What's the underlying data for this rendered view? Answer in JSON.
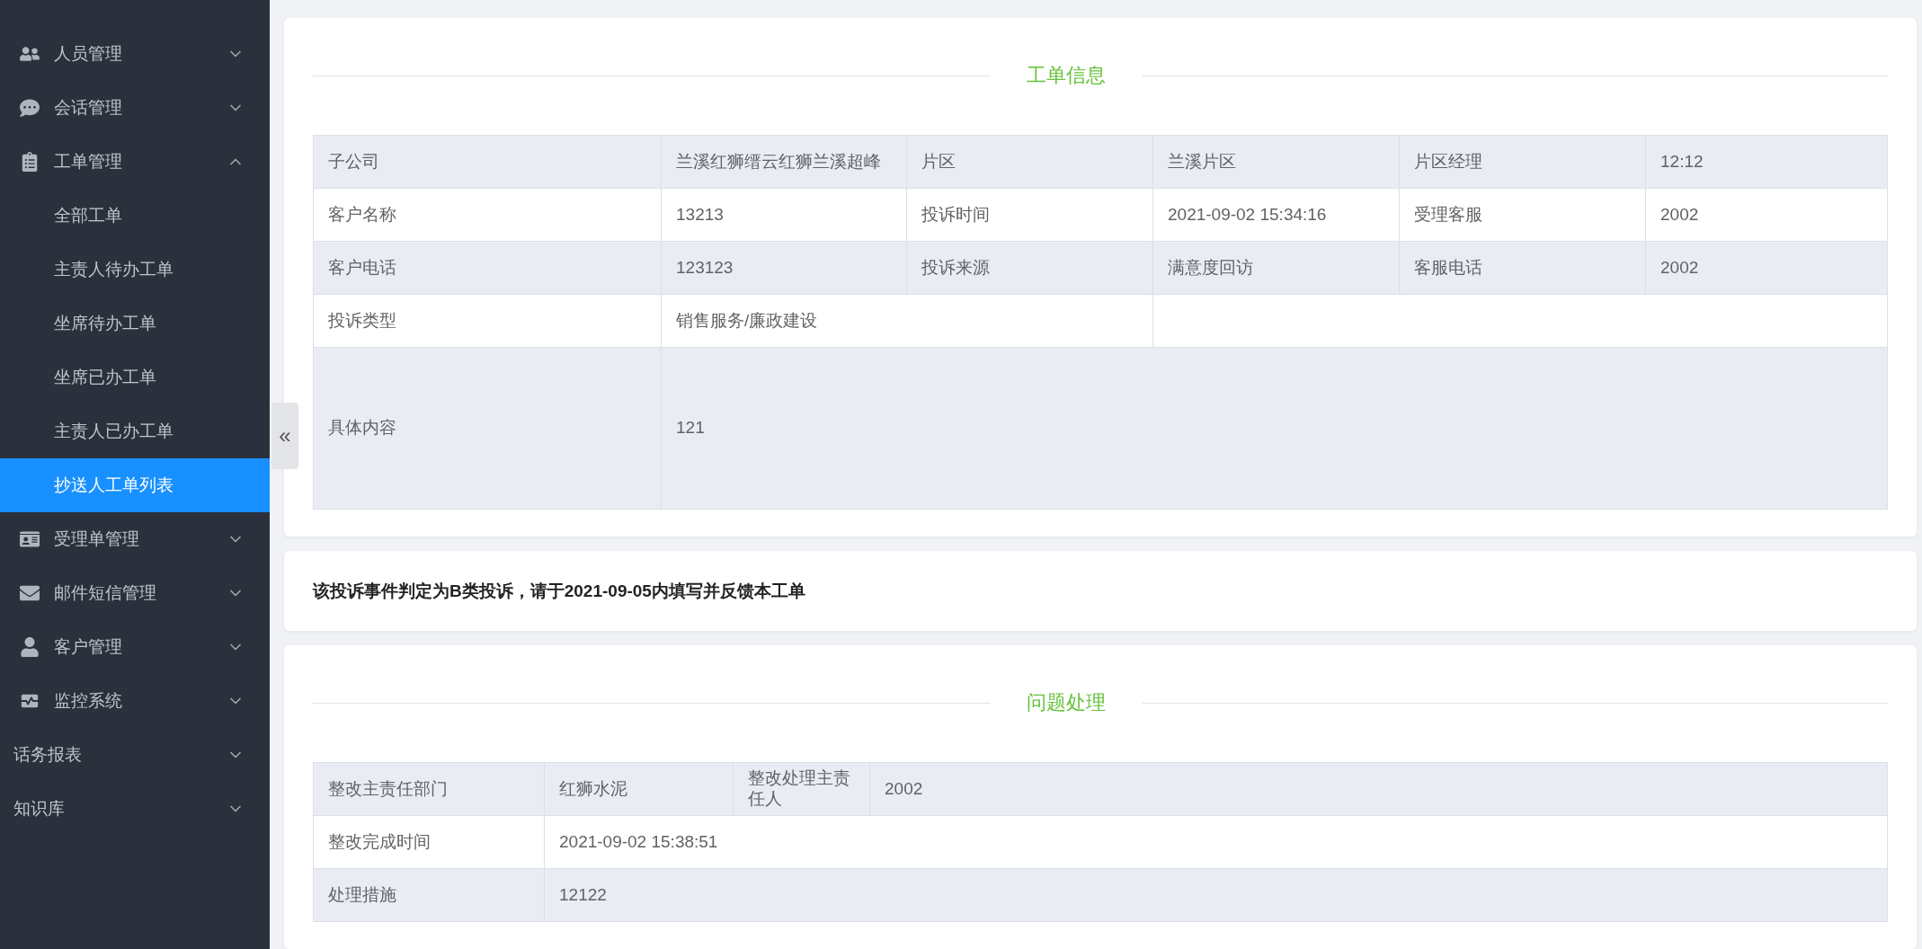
{
  "sidebar": {
    "items": [
      {
        "label": "人员管理",
        "expanded": false
      },
      {
        "label": "会话管理",
        "expanded": false
      },
      {
        "label": "工单管理",
        "expanded": true,
        "children": [
          {
            "label": "全部工单",
            "selected": false
          },
          {
            "label": "主责人待办工单",
            "selected": false
          },
          {
            "label": "坐席待办工单",
            "selected": false
          },
          {
            "label": "坐席已办工单",
            "selected": false
          },
          {
            "label": "主责人已办工单",
            "selected": false
          },
          {
            "label": "抄送人工单列表",
            "selected": true
          }
        ]
      },
      {
        "label": "受理单管理",
        "expanded": false
      },
      {
        "label": "邮件短信管理",
        "expanded": false
      },
      {
        "label": "客户管理",
        "expanded": false
      },
      {
        "label": "监控系统",
        "expanded": false
      },
      {
        "label": "话务报表",
        "expanded": false
      },
      {
        "label": "知识库",
        "expanded": false
      }
    ]
  },
  "collapse_button": {
    "label": "«"
  },
  "order_info": {
    "title": "工单信息",
    "rows": [
      {
        "kind": "grid",
        "cells": [
          "子公司",
          "兰溪红狮缙云红狮兰溪超峰",
          "片区",
          "兰溪片区",
          "片区经理",
          "12:12"
        ]
      },
      {
        "kind": "grid",
        "cells": [
          "客户名称",
          "13213",
          "投诉时间",
          "2021-09-02 15:34:16",
          "受理客服",
          "2002"
        ]
      },
      {
        "kind": "grid",
        "cells": [
          "客户电话",
          "123123",
          "投诉来源",
          "满意度回访",
          "客服电话",
          "2002"
        ]
      },
      {
        "kind": "short",
        "cells": [
          "投诉类型",
          "销售服务/廉政建设"
        ]
      },
      {
        "kind": "content",
        "cells": [
          "具体内容",
          "121"
        ]
      }
    ]
  },
  "notice": "该投诉事件判定为B类投诉，请于2021-09-05内填写并反馈本工单",
  "handling": {
    "title": "问题处理",
    "rows": [
      {
        "kind": "grid",
        "cells": [
          "整改主责任部门",
          "红狮水泥",
          "整改处理主责任人",
          "2002"
        ]
      },
      {
        "kind": "full",
        "cells": [
          "整改完成时间",
          "2021-09-02 15:38:51"
        ]
      },
      {
        "kind": "full",
        "cells": [
          "处理措施",
          "12122"
        ]
      }
    ]
  }
}
